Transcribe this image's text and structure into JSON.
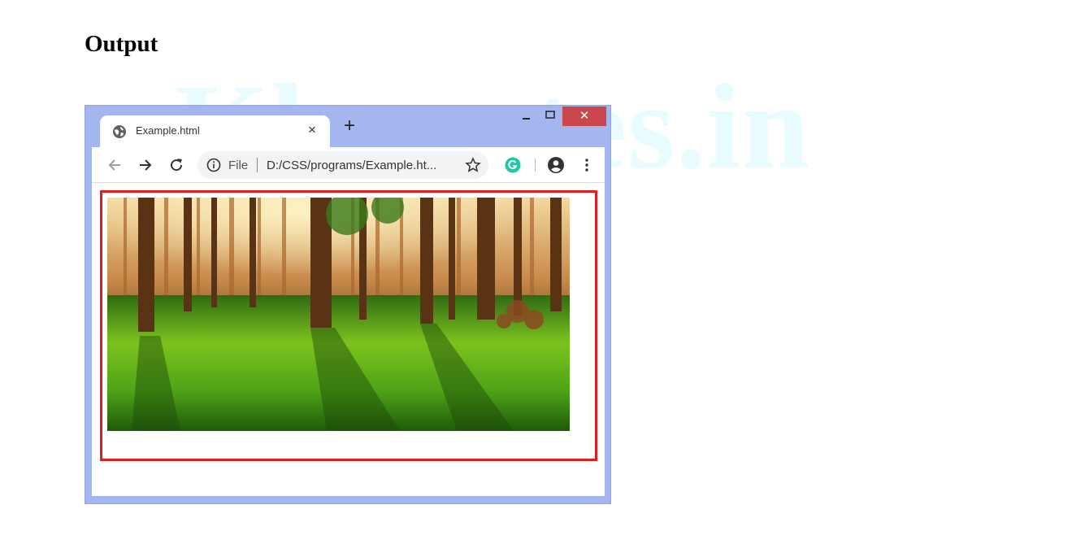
{
  "document": {
    "heading": "Output",
    "watermark": "Khanotes.in"
  },
  "browser": {
    "tab_title": "Example.html",
    "tab_close": "×",
    "new_tab": "+",
    "window_close": "✕",
    "omnibox": {
      "scheme_label": "File",
      "url": "D:/CSS/programs/Example.ht..."
    }
  },
  "page_content": {
    "image": "forest-image",
    "border_color": "#e41e1e"
  },
  "colors": {
    "browser_frame": "#a4b6f0",
    "close_button": "#c9474d",
    "extension_icon": "#1fc7a4"
  }
}
